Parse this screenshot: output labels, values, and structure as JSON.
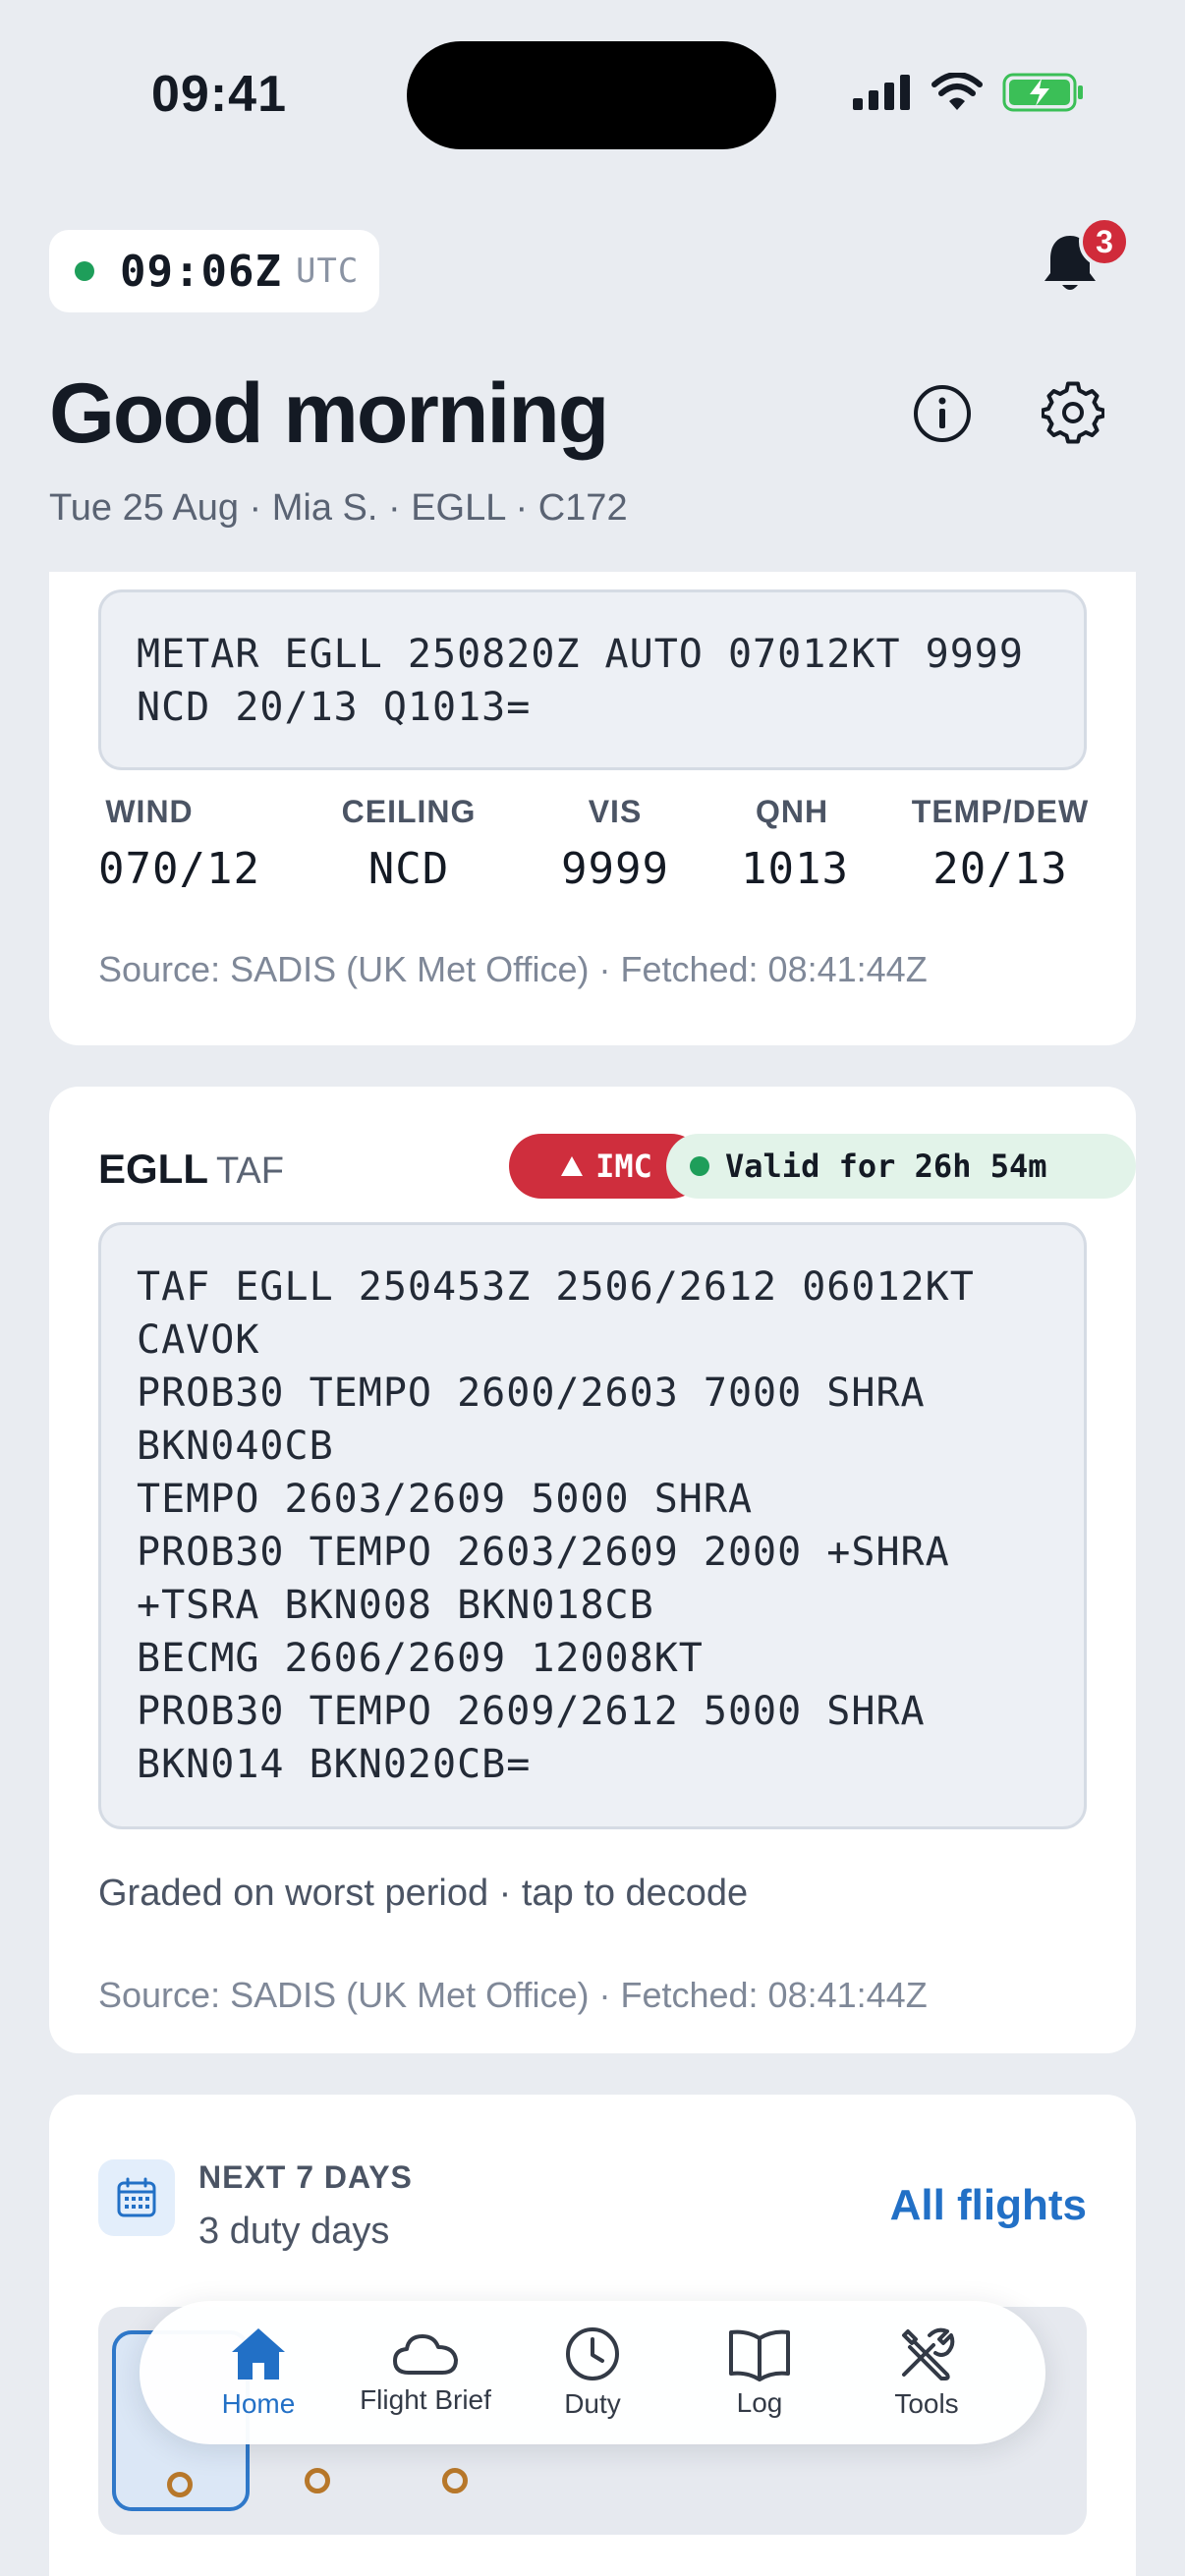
{
  "status_bar": {
    "time": "09:41"
  },
  "header": {
    "utc_time": "09:06Z",
    "utc_label": "UTC",
    "notification_count": "3",
    "greeting": "Good morning",
    "subline": "Tue 25 Aug · Mia S. · EGLL · C172"
  },
  "metar": {
    "raw": "METAR EGLL 250820Z AUTO 07012KT 9999\nNCD 20/13 Q1013=",
    "wind_label": "WIND",
    "wind_value": "070/12",
    "ceiling_label": "CEILING",
    "ceiling_value": "NCD",
    "vis_label": "VIS",
    "vis_value": "9999",
    "qnh_label": "QNH",
    "qnh_value": "1013",
    "temp_label": "TEMP/DEW",
    "temp_value": "20/13",
    "source": "Source: SADIS (UK Met Office) · Fetched: 08:41:44Z"
  },
  "taf": {
    "station": "EGLL",
    "type": "TAF",
    "category": "IMC",
    "validity": "Valid for 26h 54m",
    "raw": "TAF EGLL 250453Z 2506/2612 06012KT\nCAVOK\nPROB30 TEMPO 2600/2603 7000 SHRA\nBKN040CB\nTEMPO 2603/2609 5000 SHRA\nPROB30 TEMPO 2603/2609 2000 +SHRA\n+TSRA BKN008 BKN018CB\nBECMG 2606/2609 12008KT\nPROB30 TEMPO 2609/2612 5000 SHRA\nBKN014 BKN020CB=",
    "graded_note": "Graded on worst period · tap to decode",
    "source": "Source: SADIS (UK Met Office) · Fetched: 08:41:44Z"
  },
  "next_days": {
    "label": "NEXT 7 DAYS",
    "summary": "3 duty days",
    "link": "All flights"
  },
  "tabs": [
    {
      "label": "Home",
      "icon": "home-icon",
      "active": true
    },
    {
      "label": "Flight Brief",
      "icon": "cloud-icon",
      "active": false
    },
    {
      "label": "Duty",
      "icon": "clock-icon",
      "active": false
    },
    {
      "label": "Log",
      "icon": "book-icon",
      "active": false
    },
    {
      "label": "Tools",
      "icon": "tools-icon",
      "active": false
    }
  ],
  "colors": {
    "accent": "#2270c6",
    "imc": "#cf2e3d",
    "valid_bg": "#e2f3e9",
    "status_green": "#1e9e5a",
    "badge_red": "#d02b3a"
  }
}
